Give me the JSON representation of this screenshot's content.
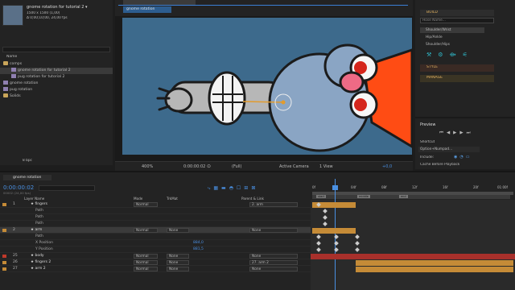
{
  "project": {
    "comp_name": "gnome rotation for tutorial 2 ▾",
    "comp_info1": "1500 x 1500 (1,00)",
    "comp_info2": "Δ 0;00;10;00, 24,00 fps",
    "search_placeholder": "",
    "col_name": "Name",
    "items": [
      {
        "label": "comps",
        "type": "folder"
      },
      {
        "label": "gnome rotation for tutorial 2",
        "type": "comp"
      },
      {
        "label": "pug rotation for tutorial 2",
        "type": "comp"
      },
      {
        "label": "gnome rotation",
        "type": "comp"
      },
      {
        "label": "pug rotation",
        "type": "comp"
      },
      {
        "label": "Solids",
        "type": "folder"
      }
    ],
    "bpc": "8 bpc"
  },
  "viewer": {
    "tab": "gnome rotation",
    "zoom": "400%",
    "timecode": "0:00:00:02",
    "resolution": "(Full)",
    "camera": "Active Camera",
    "views": "1 View",
    "exposure": "+0,0"
  },
  "duik": {
    "build": "BUILD",
    "name_placeholder": "Hose Name...",
    "items": [
      "Shoulder/Wrist",
      "Hip/Ankle",
      "Shoulder/Hips"
    ],
    "style": "STYLE",
    "manage": "MANAGE"
  },
  "preview": {
    "title": "Preview",
    "shortcut_label": "Shortcut",
    "shortcut_value": "Option+Numpad...",
    "include_label": "Include:",
    "cache_label": "Cache Before Playback"
  },
  "timeline": {
    "tab": "gnome rotation",
    "time": "0:00:00:02",
    "time_sub": "00002 (24,00 fps)",
    "col_layer": "Layer Name",
    "col_mode": "Mode",
    "col_trkmat": "TrkMat",
    "col_parent": "Parent & Link",
    "ruler": [
      "0f",
      "04f",
      "08f",
      "12f",
      "16f",
      "20f",
      "01:00f"
    ],
    "bar_labels": [
      "start",
      "middle",
      "end"
    ],
    "layers": [
      {
        "num": "1",
        "name": "fingers",
        "mode": "Normal",
        "trk": "",
        "parent": "2. arm",
        "color": "#c58b37",
        "sel": false
      },
      {
        "num": "",
        "name": "Path",
        "mode": "",
        "trk": "",
        "parent": "",
        "color": "",
        "sel": false
      },
      {
        "num": "",
        "name": "Path",
        "mode": "",
        "trk": "",
        "parent": "",
        "color": "",
        "sel": false
      },
      {
        "num": "",
        "name": "Path",
        "mode": "",
        "trk": "",
        "parent": "",
        "color": "",
        "sel": false
      },
      {
        "num": "2",
        "name": "arm",
        "mode": "Normal",
        "trk": "None",
        "parent": "None",
        "color": "#c58b37",
        "sel": true
      },
      {
        "num": "",
        "name": "Path",
        "mode": "",
        "trk": "",
        "parent": "",
        "color": "",
        "sel": false
      },
      {
        "num": "",
        "name": "X Position",
        "mode": "",
        "trk": "",
        "parent": "",
        "value": "884,0",
        "color": "",
        "sel": false
      },
      {
        "num": "",
        "name": "Y Position",
        "mode": "",
        "trk": "",
        "parent": "",
        "value": "881,5",
        "color": "",
        "sel": false
      },
      {
        "num": "25",
        "name": "body",
        "mode": "Normal",
        "trk": "None",
        "parent": "None",
        "color": "#c0392b",
        "sel": false
      },
      {
        "num": "26",
        "name": "fingers 2",
        "mode": "Normal",
        "trk": "None",
        "parent": "27. arm 2",
        "color": "#c58b37",
        "sel": false
      },
      {
        "num": "27",
        "name": "arm 2",
        "mode": "Normal",
        "trk": "None",
        "parent": "None",
        "color": "#c58b37",
        "sel": false
      }
    ]
  }
}
